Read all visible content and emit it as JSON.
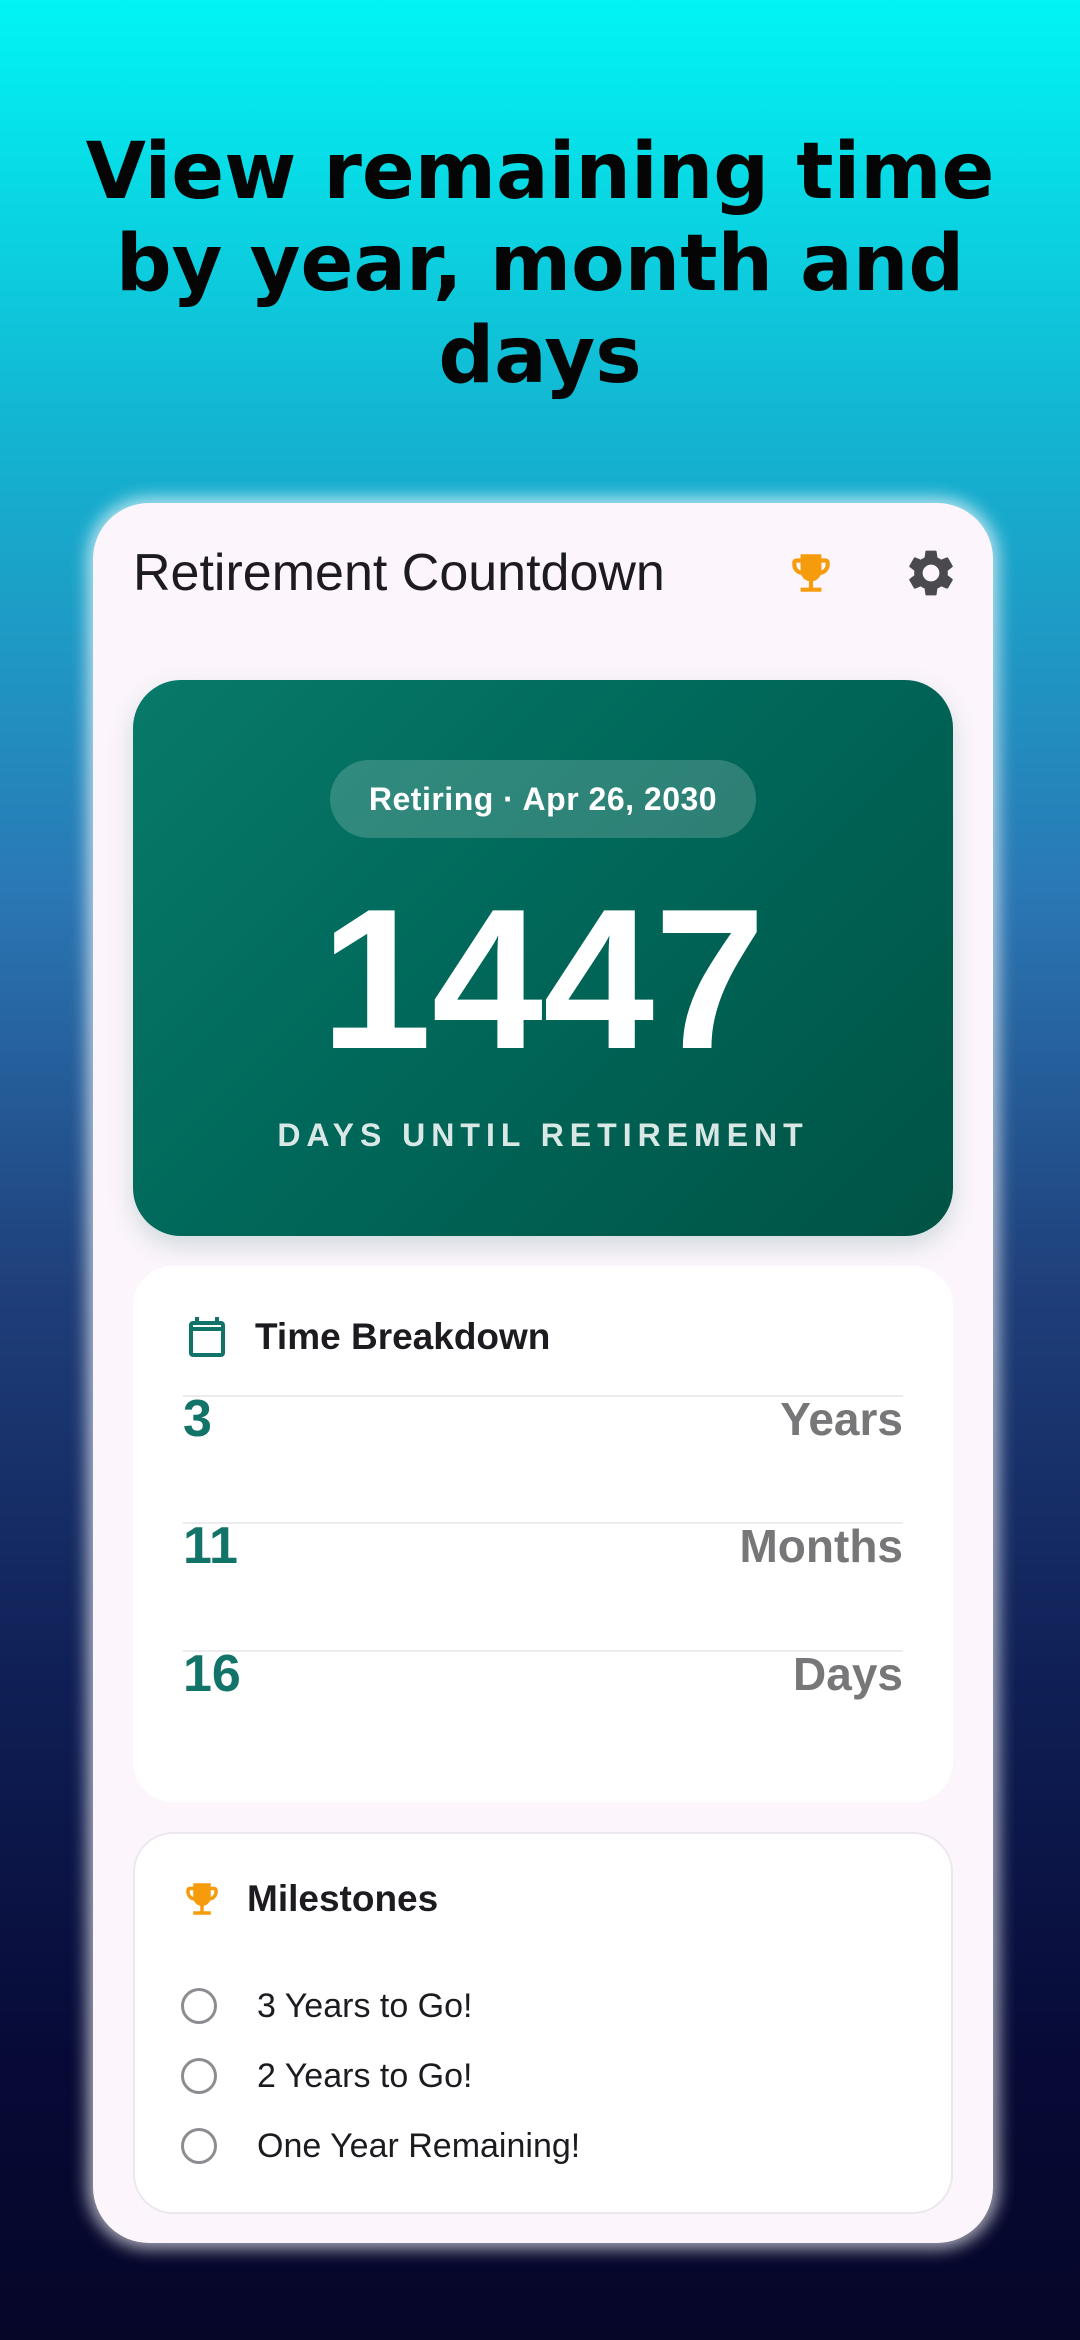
{
  "headline": "View remaining time by year, month and days",
  "app": {
    "title": "Retirement Countdown",
    "icons": {
      "achievements": "trophy-icon",
      "settings": "gear-icon"
    }
  },
  "hero": {
    "retiring_label": "Retiring · Apr 26, 2030",
    "days_count": "1447",
    "caption": "DAYS UNTIL RETIREMENT"
  },
  "breakdown": {
    "title": "Time Breakdown",
    "icon": "calendar-icon",
    "rows": [
      {
        "value": "3",
        "unit": "Years"
      },
      {
        "value": "11",
        "unit": "Months"
      },
      {
        "value": "16",
        "unit": "Days"
      }
    ]
  },
  "milestones": {
    "title": "Milestones",
    "icon": "trophy-icon",
    "items": [
      {
        "label": "3 Years to Go!",
        "checked": false
      },
      {
        "label": "2 Years to Go!",
        "checked": false
      },
      {
        "label": "One Year Remaining!",
        "checked": false
      }
    ]
  },
  "colors": {
    "accent_teal": "#127468",
    "hero_green": "#00685a",
    "trophy_orange": "#f59b0c",
    "gear_gray": "#4a4a4e",
    "muted_text": "#777779"
  }
}
